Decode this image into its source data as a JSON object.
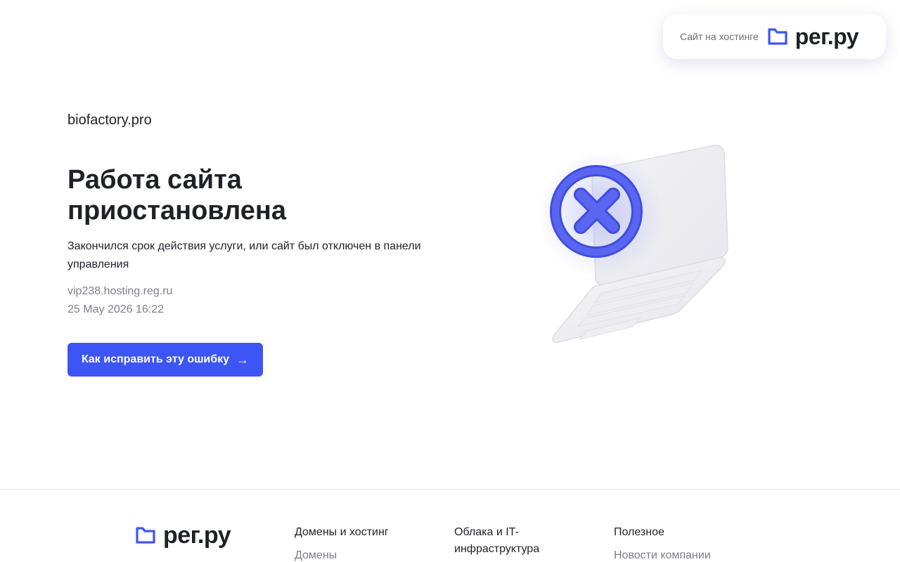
{
  "hosting_badge": {
    "text": "Сайт на хостинге",
    "logo_text": "рег.ру"
  },
  "main": {
    "domain": "biofactory.pro",
    "headline": "Работа сайта приостановлена",
    "description": "Закончился срок действия услуги, или сайт был отключен в панели управления",
    "server": "vip238.hosting.reg.ru",
    "timestamp": "25 May 2026 16:22",
    "fix_button_label": "Как исправить эту ошибку",
    "fix_button_icon": "arrow-right-icon"
  },
  "illustration": {
    "icon": "laptop-with-error-x-icon",
    "accent_color": "#4f5af0"
  },
  "footer": {
    "logo_text": "рег.ру",
    "columns": [
      {
        "title": "Домены и хостинг",
        "first_link": "Домены"
      },
      {
        "title": "Облака и IT-инфраструктура",
        "first_link": ""
      },
      {
        "title": "Полезное",
        "first_link": "Новости компании"
      }
    ]
  },
  "colors": {
    "brand": "#3d55f5",
    "text": "#1f2129",
    "muted": "#7b7f88"
  }
}
